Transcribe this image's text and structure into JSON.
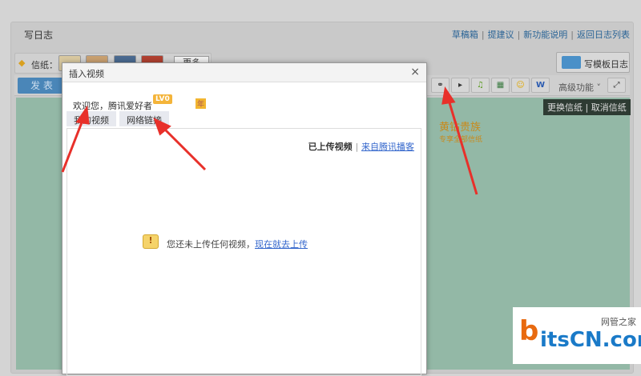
{
  "header": {
    "title": "写日志",
    "links": [
      "草稿箱",
      "提建议",
      "新功能说明",
      "返回日志列表"
    ]
  },
  "stationery": {
    "label": "信纸：",
    "more": "更多"
  },
  "template_button": "写模板日志",
  "toolbar": {
    "publish": "发 表",
    "advanced": "高级功能",
    "icons": [
      "link-icon",
      "video-icon",
      "music-icon",
      "image-icon",
      "emoji-icon",
      "word-icon"
    ]
  },
  "paper": {
    "change": "更换信纸",
    "cancel": "取消信纸",
    "vip_title": "黄钻贵族",
    "vip_sub": "专享全部信纸"
  },
  "dialog": {
    "title": "插入视频",
    "close": "×",
    "welcome": "欢迎您，腾讯爱好者",
    "level": "LV0",
    "year": "年",
    "tabs": [
      "我的视频",
      "网络链接"
    ],
    "uploaded": "已上传视频",
    "from_blog": "来自腾讯播客",
    "empty": "您还未上传任何视频，",
    "upload_link": "现在就去上传"
  },
  "watermark": {
    "brand": "itsCN.com",
    "cn": "网管之家"
  },
  "colors": {
    "link": "#2a6496",
    "arrow": "#e8302a",
    "publish": "#4a86b8"
  }
}
